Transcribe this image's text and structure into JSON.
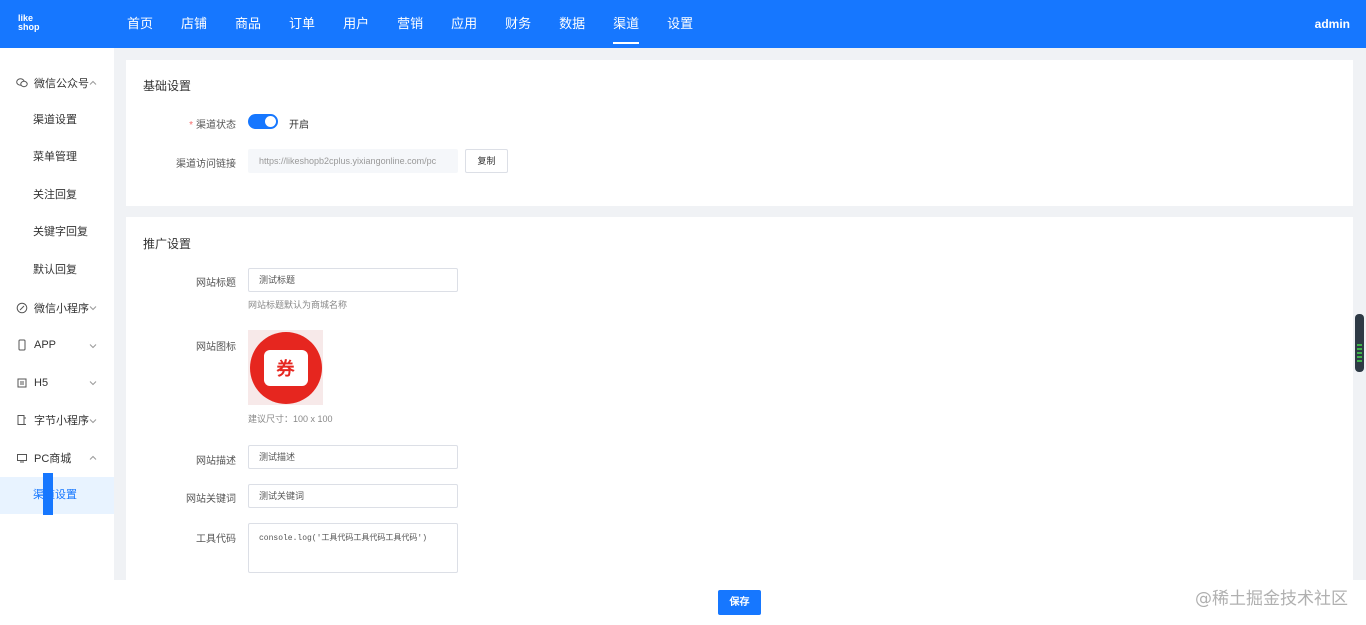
{
  "header": {
    "logo": [
      "like",
      "shop"
    ],
    "nav": [
      "首页",
      "店铺",
      "商品",
      "订单",
      "用户",
      "营销",
      "应用",
      "财务",
      "数据",
      "渠道",
      "设置"
    ],
    "active_nav": "渠道",
    "user": "admin"
  },
  "sidebar": {
    "groups": [
      {
        "icon": "wechat-icon",
        "label": "微信公众号",
        "expanded": true,
        "items": [
          "渠道设置",
          "菜单管理",
          "关注回复",
          "关键字回复",
          "默认回复"
        ]
      },
      {
        "icon": "compass-icon",
        "label": "微信小程序",
        "expanded": false
      },
      {
        "icon": "phone-icon",
        "label": "APP",
        "expanded": false
      },
      {
        "icon": "h5-icon",
        "label": "H5",
        "expanded": false
      },
      {
        "icon": "bytedance-icon",
        "label": "字节小程序",
        "expanded": false
      },
      {
        "icon": "monitor-icon",
        "label": "PC商城",
        "expanded": true,
        "items": [
          "渠道设置"
        ]
      }
    ]
  },
  "basic": {
    "title": "基础设置",
    "status_label": "渠道状态",
    "status_text": "开启",
    "link_label": "渠道访问链接",
    "link_value": "https://likeshopb2cplus.yixiangonline.com/pc",
    "copy_label": "复制"
  },
  "promo": {
    "title": "推广设置",
    "site_title_label": "网站标题",
    "site_title_value": "测试标题",
    "site_title_help": "网站标题默认为商城名称",
    "site_icon_label": "网站图标",
    "icon_glyph": "券",
    "icon_help": "建议尺寸：100 x 100",
    "desc_label": "网站描述",
    "desc_value": "测试描述",
    "keywords_label": "网站关键词",
    "keywords_value": "测试关键词",
    "tool_label": "工具代码",
    "tool_value": "console.log('工具代码工具代码工具代码')"
  },
  "footer": {
    "save_label": "保存",
    "watermark": "@稀土掘金技术社区"
  },
  "colors": {
    "primary": "#1677ff",
    "background": "#f0f2f5",
    "required": "#f56c6c"
  }
}
